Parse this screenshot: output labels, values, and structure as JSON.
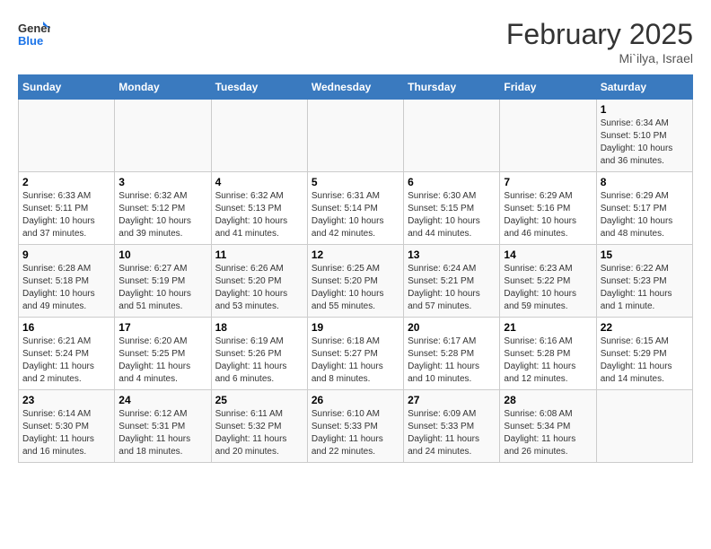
{
  "header": {
    "logo_general": "General",
    "logo_blue": "Blue",
    "title": "February 2025",
    "location": "Mi`ilya, Israel"
  },
  "days_of_week": [
    "Sunday",
    "Monday",
    "Tuesday",
    "Wednesday",
    "Thursday",
    "Friday",
    "Saturday"
  ],
  "weeks": [
    {
      "days": [
        {
          "num": "",
          "info": ""
        },
        {
          "num": "",
          "info": ""
        },
        {
          "num": "",
          "info": ""
        },
        {
          "num": "",
          "info": ""
        },
        {
          "num": "",
          "info": ""
        },
        {
          "num": "",
          "info": ""
        },
        {
          "num": "1",
          "info": "Sunrise: 6:34 AM\nSunset: 5:10 PM\nDaylight: 10 hours and 36 minutes."
        }
      ]
    },
    {
      "days": [
        {
          "num": "2",
          "info": "Sunrise: 6:33 AM\nSunset: 5:11 PM\nDaylight: 10 hours and 37 minutes."
        },
        {
          "num": "3",
          "info": "Sunrise: 6:32 AM\nSunset: 5:12 PM\nDaylight: 10 hours and 39 minutes."
        },
        {
          "num": "4",
          "info": "Sunrise: 6:32 AM\nSunset: 5:13 PM\nDaylight: 10 hours and 41 minutes."
        },
        {
          "num": "5",
          "info": "Sunrise: 6:31 AM\nSunset: 5:14 PM\nDaylight: 10 hours and 42 minutes."
        },
        {
          "num": "6",
          "info": "Sunrise: 6:30 AM\nSunset: 5:15 PM\nDaylight: 10 hours and 44 minutes."
        },
        {
          "num": "7",
          "info": "Sunrise: 6:29 AM\nSunset: 5:16 PM\nDaylight: 10 hours and 46 minutes."
        },
        {
          "num": "8",
          "info": "Sunrise: 6:29 AM\nSunset: 5:17 PM\nDaylight: 10 hours and 48 minutes."
        }
      ]
    },
    {
      "days": [
        {
          "num": "9",
          "info": "Sunrise: 6:28 AM\nSunset: 5:18 PM\nDaylight: 10 hours and 49 minutes."
        },
        {
          "num": "10",
          "info": "Sunrise: 6:27 AM\nSunset: 5:19 PM\nDaylight: 10 hours and 51 minutes."
        },
        {
          "num": "11",
          "info": "Sunrise: 6:26 AM\nSunset: 5:20 PM\nDaylight: 10 hours and 53 minutes."
        },
        {
          "num": "12",
          "info": "Sunrise: 6:25 AM\nSunset: 5:20 PM\nDaylight: 10 hours and 55 minutes."
        },
        {
          "num": "13",
          "info": "Sunrise: 6:24 AM\nSunset: 5:21 PM\nDaylight: 10 hours and 57 minutes."
        },
        {
          "num": "14",
          "info": "Sunrise: 6:23 AM\nSunset: 5:22 PM\nDaylight: 10 hours and 59 minutes."
        },
        {
          "num": "15",
          "info": "Sunrise: 6:22 AM\nSunset: 5:23 PM\nDaylight: 11 hours and 1 minute."
        }
      ]
    },
    {
      "days": [
        {
          "num": "16",
          "info": "Sunrise: 6:21 AM\nSunset: 5:24 PM\nDaylight: 11 hours and 2 minutes."
        },
        {
          "num": "17",
          "info": "Sunrise: 6:20 AM\nSunset: 5:25 PM\nDaylight: 11 hours and 4 minutes."
        },
        {
          "num": "18",
          "info": "Sunrise: 6:19 AM\nSunset: 5:26 PM\nDaylight: 11 hours and 6 minutes."
        },
        {
          "num": "19",
          "info": "Sunrise: 6:18 AM\nSunset: 5:27 PM\nDaylight: 11 hours and 8 minutes."
        },
        {
          "num": "20",
          "info": "Sunrise: 6:17 AM\nSunset: 5:28 PM\nDaylight: 11 hours and 10 minutes."
        },
        {
          "num": "21",
          "info": "Sunrise: 6:16 AM\nSunset: 5:28 PM\nDaylight: 11 hours and 12 minutes."
        },
        {
          "num": "22",
          "info": "Sunrise: 6:15 AM\nSunset: 5:29 PM\nDaylight: 11 hours and 14 minutes."
        }
      ]
    },
    {
      "days": [
        {
          "num": "23",
          "info": "Sunrise: 6:14 AM\nSunset: 5:30 PM\nDaylight: 11 hours and 16 minutes."
        },
        {
          "num": "24",
          "info": "Sunrise: 6:12 AM\nSunset: 5:31 PM\nDaylight: 11 hours and 18 minutes."
        },
        {
          "num": "25",
          "info": "Sunrise: 6:11 AM\nSunset: 5:32 PM\nDaylight: 11 hours and 20 minutes."
        },
        {
          "num": "26",
          "info": "Sunrise: 6:10 AM\nSunset: 5:33 PM\nDaylight: 11 hours and 22 minutes."
        },
        {
          "num": "27",
          "info": "Sunrise: 6:09 AM\nSunset: 5:33 PM\nDaylight: 11 hours and 24 minutes."
        },
        {
          "num": "28",
          "info": "Sunrise: 6:08 AM\nSunset: 5:34 PM\nDaylight: 11 hours and 26 minutes."
        },
        {
          "num": "",
          "info": ""
        }
      ]
    }
  ]
}
